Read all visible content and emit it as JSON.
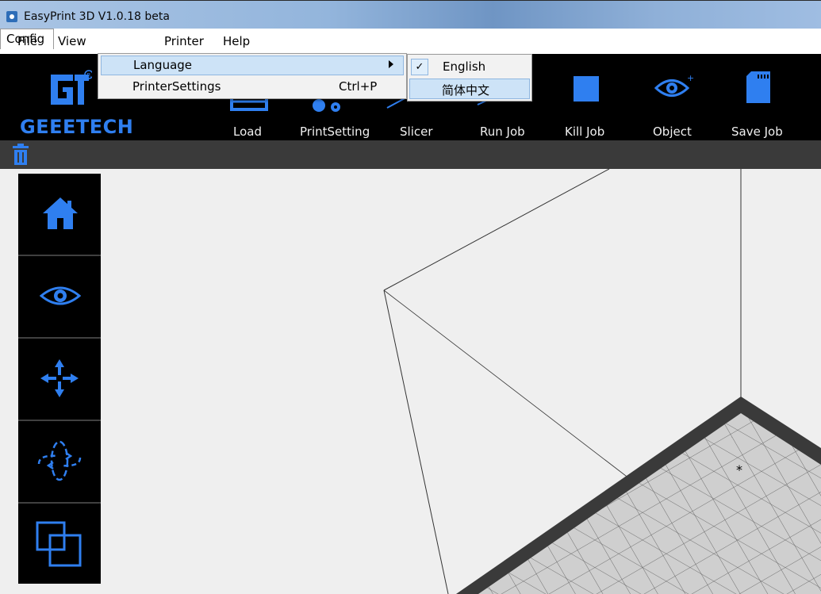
{
  "window": {
    "title": "EasyPrint 3D  V1.0.18 beta"
  },
  "menubar": {
    "items": [
      {
        "label": "File"
      },
      {
        "label": "View"
      },
      {
        "label": "Config"
      },
      {
        "label": "Printer"
      },
      {
        "label": "Help"
      }
    ]
  },
  "config_menu": {
    "items": [
      {
        "label": "Language",
        "submenu": true,
        "highlighted": true
      },
      {
        "label": "PrinterSettings",
        "shortcut": "Ctrl+P"
      }
    ]
  },
  "language_menu": {
    "items": [
      {
        "label": "English",
        "checked": true
      },
      {
        "label": "简体中文",
        "highlighted": true
      }
    ]
  },
  "toolbar": {
    "logo_text": "GEEETECH",
    "buttons": [
      {
        "label": "Load",
        "icon": "load-icon"
      },
      {
        "label": "PrintSetting",
        "icon": "print-setting-icon"
      },
      {
        "label": "Slicer",
        "icon": "slicer-icon"
      },
      {
        "label": "Run Job",
        "icon": "run-job-icon"
      },
      {
        "label": "Kill Job",
        "icon": "stop-square-icon"
      },
      {
        "label": "Object",
        "icon": "eye-icon"
      },
      {
        "label": "Save Job",
        "icon": "sd-card-icon"
      }
    ]
  },
  "side_panel": {
    "buttons": [
      {
        "icon": "home-icon"
      },
      {
        "icon": "eye-icon"
      },
      {
        "icon": "move-arrows-icon"
      },
      {
        "icon": "rotate-icon"
      },
      {
        "icon": "scale-squares-icon"
      }
    ]
  },
  "viewport": {
    "origin_marker": "*"
  },
  "colors": {
    "accent": "#2f7ff0",
    "toolbar_bg": "#000000",
    "subbar_bg": "#3a3a3a",
    "viewport_bg": "#efefef",
    "menu_highlight": "#cde3f7"
  }
}
